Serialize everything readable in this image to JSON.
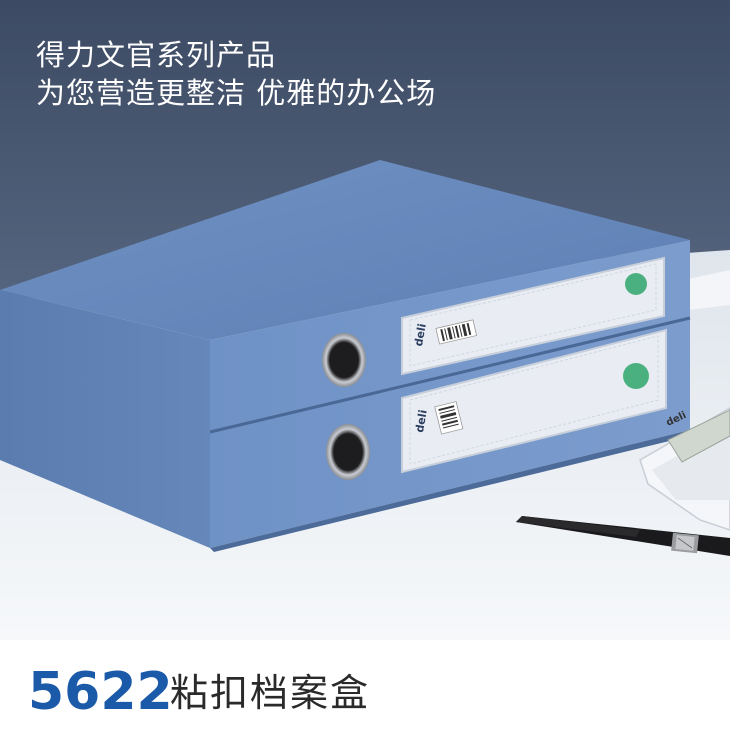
{
  "headline": {
    "line1": "得力文官系列产品",
    "line2": "为您营造更整洁 优雅的办公场"
  },
  "box_labels": {
    "brand_top": "deli",
    "brand_bottom": "deli"
  },
  "calculator": {
    "brand": "deli"
  },
  "footer": {
    "model_number": "5622",
    "product_name": "粘扣档案盒"
  },
  "colors": {
    "wall": "#4a5872",
    "box_blue": "#6a8cbf",
    "model_number_blue": "#1b5aa8",
    "table": "#e9edf2"
  }
}
